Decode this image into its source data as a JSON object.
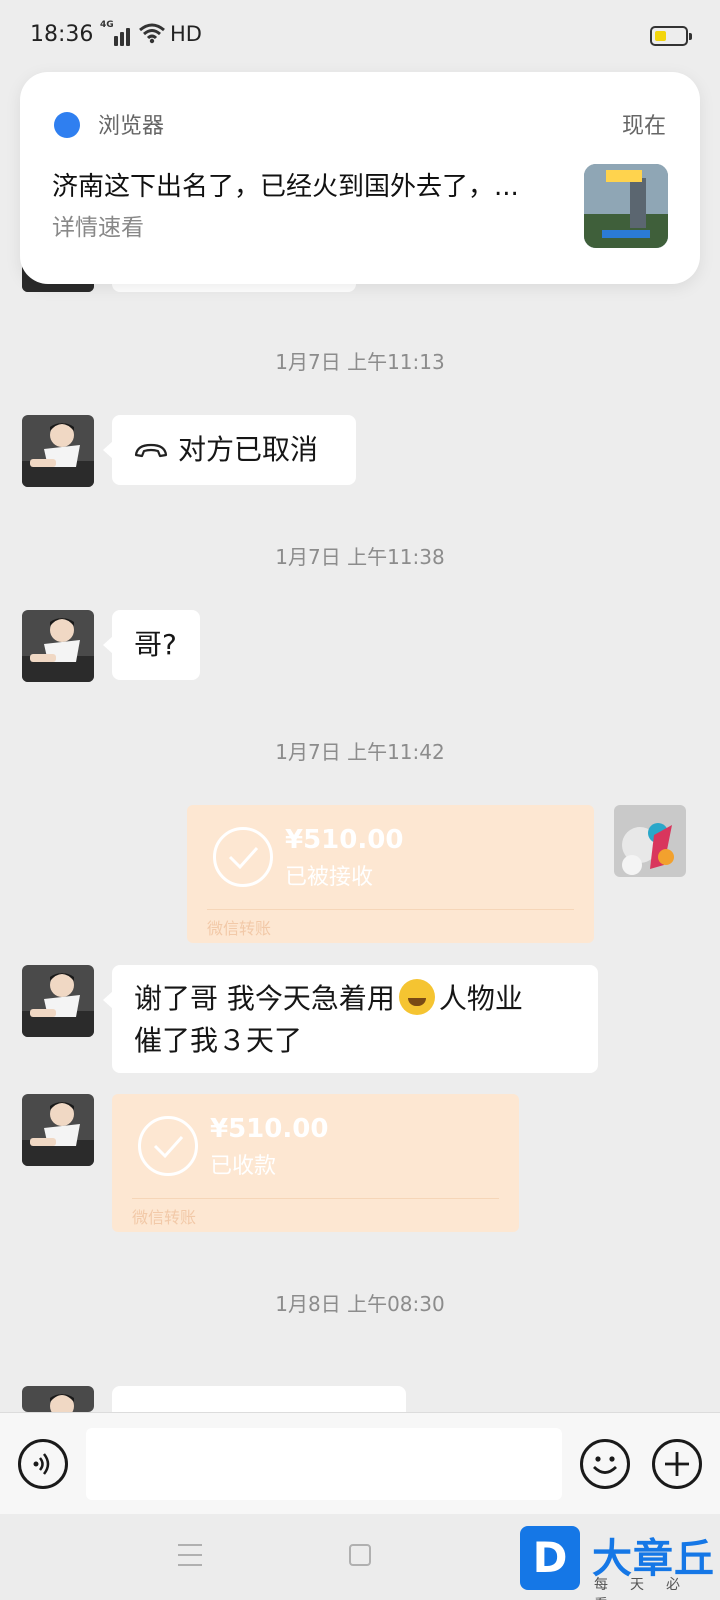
{
  "status_bar": {
    "time": "18:36",
    "network": "4G",
    "hd": "HD",
    "battery_level": 0.4
  },
  "notification": {
    "app_name": "浏览器",
    "time": "现在",
    "title": "济南这下出名了，已经火到国外去了，...",
    "subtitle": "详情速看"
  },
  "messages": [
    {
      "type": "timestamp",
      "text": "1月7日 上午11:13"
    },
    {
      "type": "call",
      "sender": "other",
      "text": "对方已取消",
      "icon": "hangup-phone-icon"
    },
    {
      "type": "timestamp",
      "text": "1月7日 上午11:38"
    },
    {
      "type": "text",
      "sender": "other",
      "text": "哥?"
    },
    {
      "type": "timestamp",
      "text": "1月7日 上午11:42"
    },
    {
      "type": "transfer",
      "sender": "me",
      "amount": "¥510.00",
      "status": "已被接收",
      "brand": "微信转账"
    },
    {
      "type": "text",
      "sender": "other",
      "line1a": "谢了哥   我今天急着用",
      "line1b": "人物业",
      "line2": "催了我３天了",
      "emoji": "crying-laughing-emoji"
    },
    {
      "type": "transfer",
      "sender": "other",
      "amount": "¥510.00",
      "status": "已收款",
      "brand": "微信转账"
    },
    {
      "type": "timestamp",
      "text": "1月8日 上午08:30"
    }
  ],
  "watermark": {
    "logo_letter": "D",
    "name": "大章丘",
    "slogan": "每天必看"
  },
  "colors": {
    "chat_background": "#ededed",
    "transfer_card": "#fde7d2",
    "watermark_blue": "#1577e6"
  }
}
